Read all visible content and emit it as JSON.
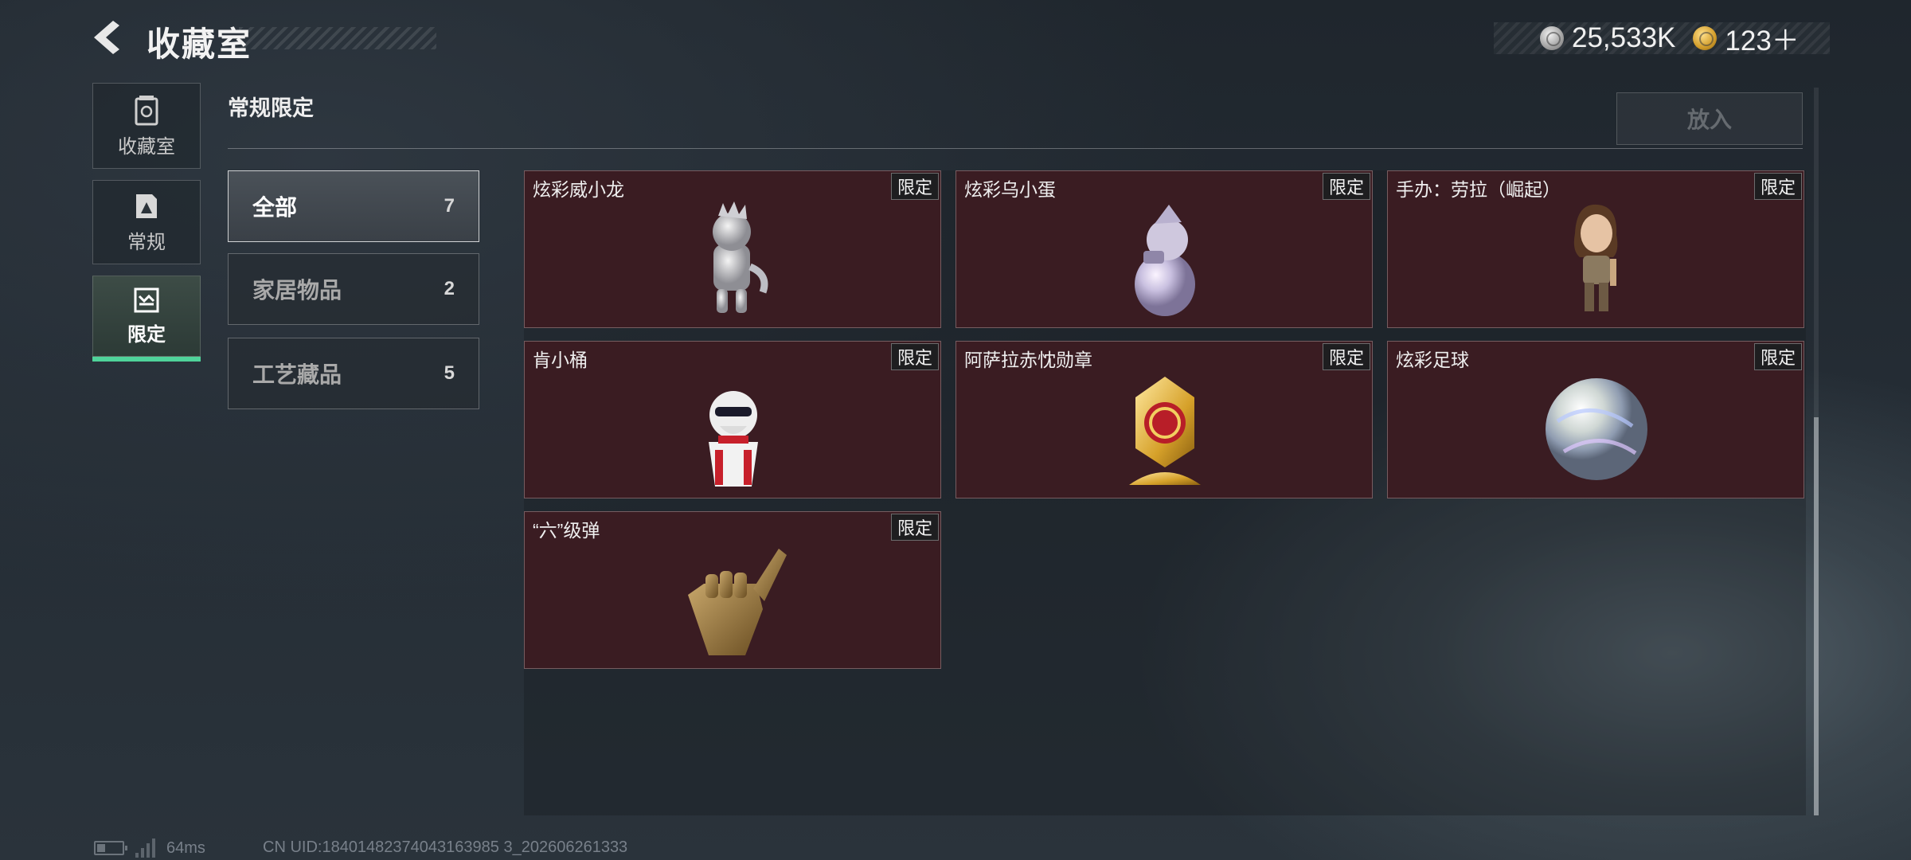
{
  "header": {
    "title": "收藏室",
    "currencies": [
      {
        "icon": "silver-coin-icon",
        "amount": "25,533K"
      },
      {
        "icon": "gold-coin-icon",
        "amount": "123＋"
      }
    ]
  },
  "nav": {
    "tabs": [
      {
        "label": "收藏室",
        "icon": "collection-room-icon",
        "active": false
      },
      {
        "label": "常规",
        "icon": "regular-icon",
        "active": false
      },
      {
        "label": "限定",
        "icon": "limited-icon",
        "active": true
      }
    ]
  },
  "section": {
    "title": "常规限定",
    "put_button": "放入"
  },
  "categories": [
    {
      "name": "全部",
      "count": "7",
      "active": true
    },
    {
      "name": "家居物品",
      "count": "2",
      "active": false
    },
    {
      "name": "工艺藏品",
      "count": "5",
      "active": false
    }
  ],
  "items": [
    {
      "name": "炫彩威小龙",
      "tag": "限定",
      "icon": "dragon-figure-icon"
    },
    {
      "name": "炫彩乌小蛋",
      "tag": "限定",
      "icon": "egg-figure-icon"
    },
    {
      "name": "手办：劳拉（崛起）",
      "tag": "限定",
      "icon": "lara-figure-icon"
    },
    {
      "name": "肯小桶",
      "tag": "限定",
      "icon": "kfc-bucket-figure-icon"
    },
    {
      "name": "阿萨拉赤忱勋章",
      "tag": "限定",
      "icon": "medal-icon"
    },
    {
      "name": "炫彩足球",
      "tag": "限定",
      "icon": "iridescent-ball-icon"
    },
    {
      "name": "“六”级弹",
      "tag": "限定",
      "icon": "six-hand-sign-icon"
    }
  ],
  "footer": {
    "ping": "64ms",
    "uid": "CN UID:18401482374043163985 3_202606261333"
  },
  "colors": {
    "accent": "#4fd39a",
    "card_bg": "#3a1c22",
    "tag_bg": "#1e1e20"
  }
}
